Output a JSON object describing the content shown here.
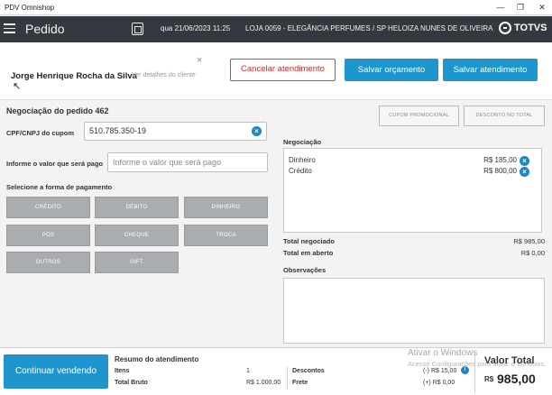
{
  "window": {
    "title": "PDV Omnishop",
    "minimize_icon": "minimize-icon",
    "maximize_icon": "maximize-icon",
    "close_icon": "close-icon"
  },
  "appbar": {
    "page_title": "Pedido",
    "datetime": "qua 21/06/2023 11:25",
    "store": "LOJA 0059 - ELEGÂNCIA PERFUMES / SP",
    "user": "HELOIZA NUNES DE OLIVEIRA",
    "logo": "TOTVS"
  },
  "customer": {
    "name": "Jorge Henrique Rocha da Silva",
    "details_link": "Ver detalhes do cliente",
    "close": "×",
    "cancel_button": "Cancelar atendimento",
    "save_quote_button": "Salvar orçamento",
    "save_service_button": "Salvar atendimento"
  },
  "negotiation": {
    "title": "Negociação do pedido 462",
    "cpf_label": "CPF/CNPJ do cupom",
    "cpf_value": "510.785.350-19",
    "amount_label": "Informe o valor que será pago",
    "amount_placeholder": "Informe o valor que será pago",
    "payment_label": "Selecione a forma de pagamento",
    "payment_methods": [
      "CRÉDITO",
      "DÉBITO",
      "DINHEIRO",
      "POS",
      "CHEQUE",
      "TROCA",
      "OUTROS",
      "GIFT"
    ],
    "promo_button": "CUPOM PROMOCIONAL",
    "discount_button": "DESCONTO NO TOTAL"
  },
  "negotiation_panel": {
    "title": "Negociação",
    "items": [
      {
        "name": "Dinheiro",
        "amount": "R$ 185,00"
      },
      {
        "name": "Crédito",
        "amount": "R$ 800,00"
      }
    ],
    "total_negotiated_label": "Total negociado",
    "total_negotiated_value": "R$ 985,00",
    "total_open_label": "Total em aberto",
    "total_open_value": "R$ 0,00",
    "observations_label": "Observações"
  },
  "footer": {
    "continue_button": "Continuar vendendo",
    "summary_title": "Resumo do atendimento",
    "items_label": "Itens",
    "items_value": "1",
    "gross_label": "Total Bruto",
    "gross_value": "R$ 1.000,00",
    "discounts_label": "Descontos",
    "discounts_value": "(-) R$ 15,00",
    "freight_label": "Frete",
    "freight_value": "(+) R$ 0,00",
    "total_label": "Valor Total",
    "total_currency": "R$",
    "total_value": "985,00",
    "watermark_line1": "Ativar o Windows",
    "watermark_line2": "Acesse Configurações para ativar o Windows."
  }
}
